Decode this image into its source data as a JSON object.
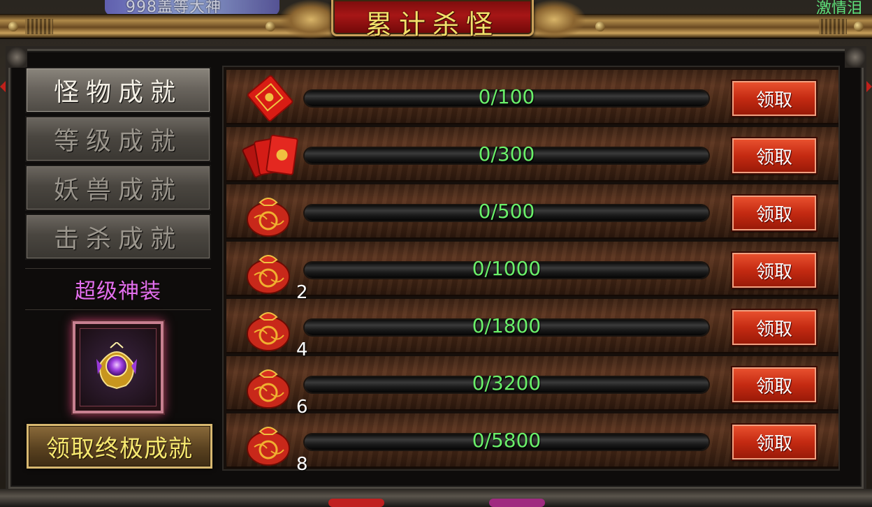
{
  "title": "累计杀怪",
  "background": {
    "top_left_text": "998盖等大神",
    "top_right_text": "激情泪"
  },
  "nav": {
    "items": [
      {
        "label": "怪物成就",
        "active": true
      },
      {
        "label": "等级成就",
        "active": false
      },
      {
        "label": "妖兽成就",
        "active": false
      },
      {
        "label": "击杀成就",
        "active": false
      }
    ]
  },
  "super": {
    "label": "超级神装",
    "claim_label": "领取终极成就"
  },
  "rows": [
    {
      "icon": "red-envelope-icon",
      "progress_text": "0/100",
      "progress": 0,
      "count": "",
      "claim_label": "领取"
    },
    {
      "icon": "red-envelopes-icon",
      "progress_text": "0/300",
      "progress": 0,
      "count": "",
      "claim_label": "领取"
    },
    {
      "icon": "lucky-bag-icon",
      "progress_text": "0/500",
      "progress": 0,
      "count": "",
      "claim_label": "领取"
    },
    {
      "icon": "lucky-bag-icon",
      "progress_text": "0/1000",
      "progress": 0,
      "count": "2",
      "claim_label": "领取"
    },
    {
      "icon": "lucky-bag-icon",
      "progress_text": "0/1800",
      "progress": 0,
      "count": "4",
      "claim_label": "领取"
    },
    {
      "icon": "lucky-bag-icon",
      "progress_text": "0/3200",
      "progress": 0,
      "count": "6",
      "claim_label": "领取"
    },
    {
      "icon": "lucky-bag-icon",
      "progress_text": "0/5800",
      "progress": 0,
      "count": "8",
      "claim_label": "领取"
    }
  ],
  "colors": {
    "title_text": "#f4e06a",
    "progress_text": "#6aef6a",
    "super_label": "#e070f0",
    "claim_button": "#c42a12"
  }
}
